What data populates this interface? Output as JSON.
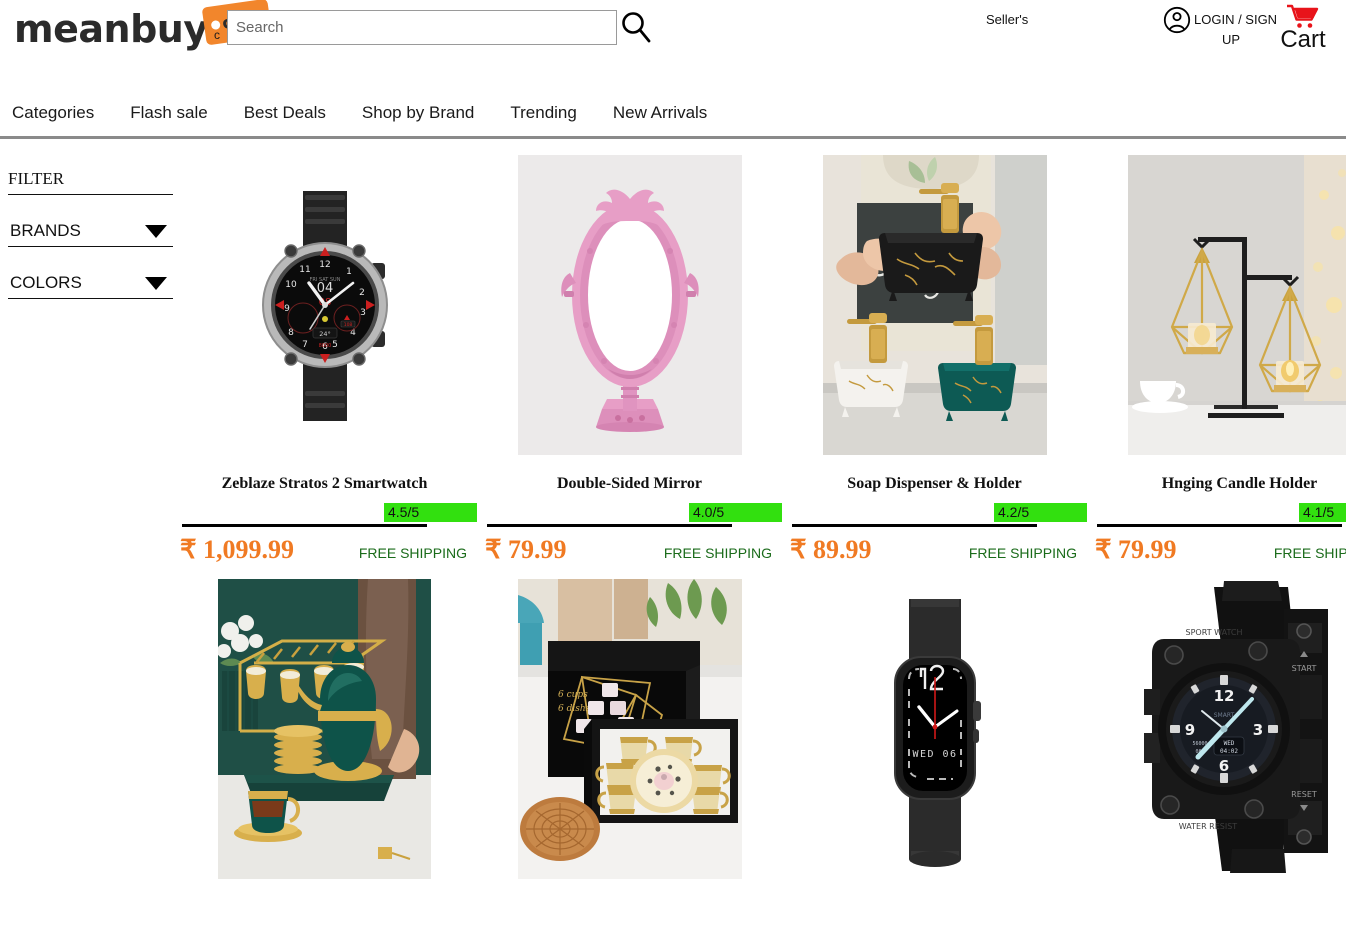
{
  "header": {
    "logo_text": "meanbuy",
    "logo_tag_text": "com",
    "logo_sub": "c",
    "search": {
      "placeholder": "Search",
      "value": "",
      "icon": "search-icon"
    },
    "sellers_label": "Seller's",
    "account": {
      "icon": "user-circle-icon",
      "label_line1": "LOGIN / SIGN",
      "label_line2": "UP"
    },
    "cart": {
      "icon": "shopping-cart-icon",
      "label": "Cart"
    }
  },
  "nav": {
    "items": [
      {
        "label": "Categories"
      },
      {
        "label": "Flash sale"
      },
      {
        "label": "Best Deals"
      },
      {
        "label": "Shop by Brand"
      },
      {
        "label": "Trending"
      },
      {
        "label": "New Arrivals"
      }
    ]
  },
  "sidebar": {
    "title": "FILTER",
    "groups": [
      {
        "label": "BRANDS",
        "icon": "chevron-down-icon"
      },
      {
        "label": "COLORS",
        "icon": "chevron-down-icon"
      }
    ]
  },
  "products": {
    "row1": [
      {
        "title": "Zeblaze Stratos 2 Smartwatch",
        "rating": "4.5/5",
        "price": "₹ 1,099.99",
        "shipping": "FREE SHIPPING",
        "image_name": "zeblaze-stratos-2-smartwatch-image"
      },
      {
        "title": "Double-Sided Mirror",
        "rating": "4.0/5",
        "price": "₹ 79.99",
        "shipping": "FREE SHIPPING",
        "image_name": "double-sided-mirror-image"
      },
      {
        "title": "Soap Dispenser & Holder",
        "rating": "4.2/5",
        "price": "₹ 89.99",
        "shipping": "FREE SHIPPING",
        "image_name": "soap-dispenser-holder-image"
      },
      {
        "title": "Hnging Candle Holder",
        "rating": "4.1/5",
        "price": "₹ 79.99",
        "shipping": "FREE SHIPPING",
        "image_name": "hanging-candle-holder-image"
      }
    ],
    "row2": [
      {
        "image_name": "teal-gold-tea-set-image"
      },
      {
        "image_name": "gold-teacup-gift-set-image"
      },
      {
        "image_name": "black-square-smartwatch-image"
      },
      {
        "image_name": "tactical-sports-watch-image"
      }
    ]
  },
  "colors": {
    "brand_orange": "#f2862c",
    "price_orange": "#f07a23",
    "rating_green": "#32e00f",
    "shipping_green": "#1a6b1a",
    "cart_red": "#e8131a",
    "divider_gray": "#8a8a8a"
  },
  "watch_faces": {
    "square_watch_date": "WED 06",
    "tactical_watch_numerals": [
      "12",
      "3",
      "6",
      "9"
    ],
    "tactical_watch_start": "START",
    "tactical_watch_reset": "RESET"
  }
}
